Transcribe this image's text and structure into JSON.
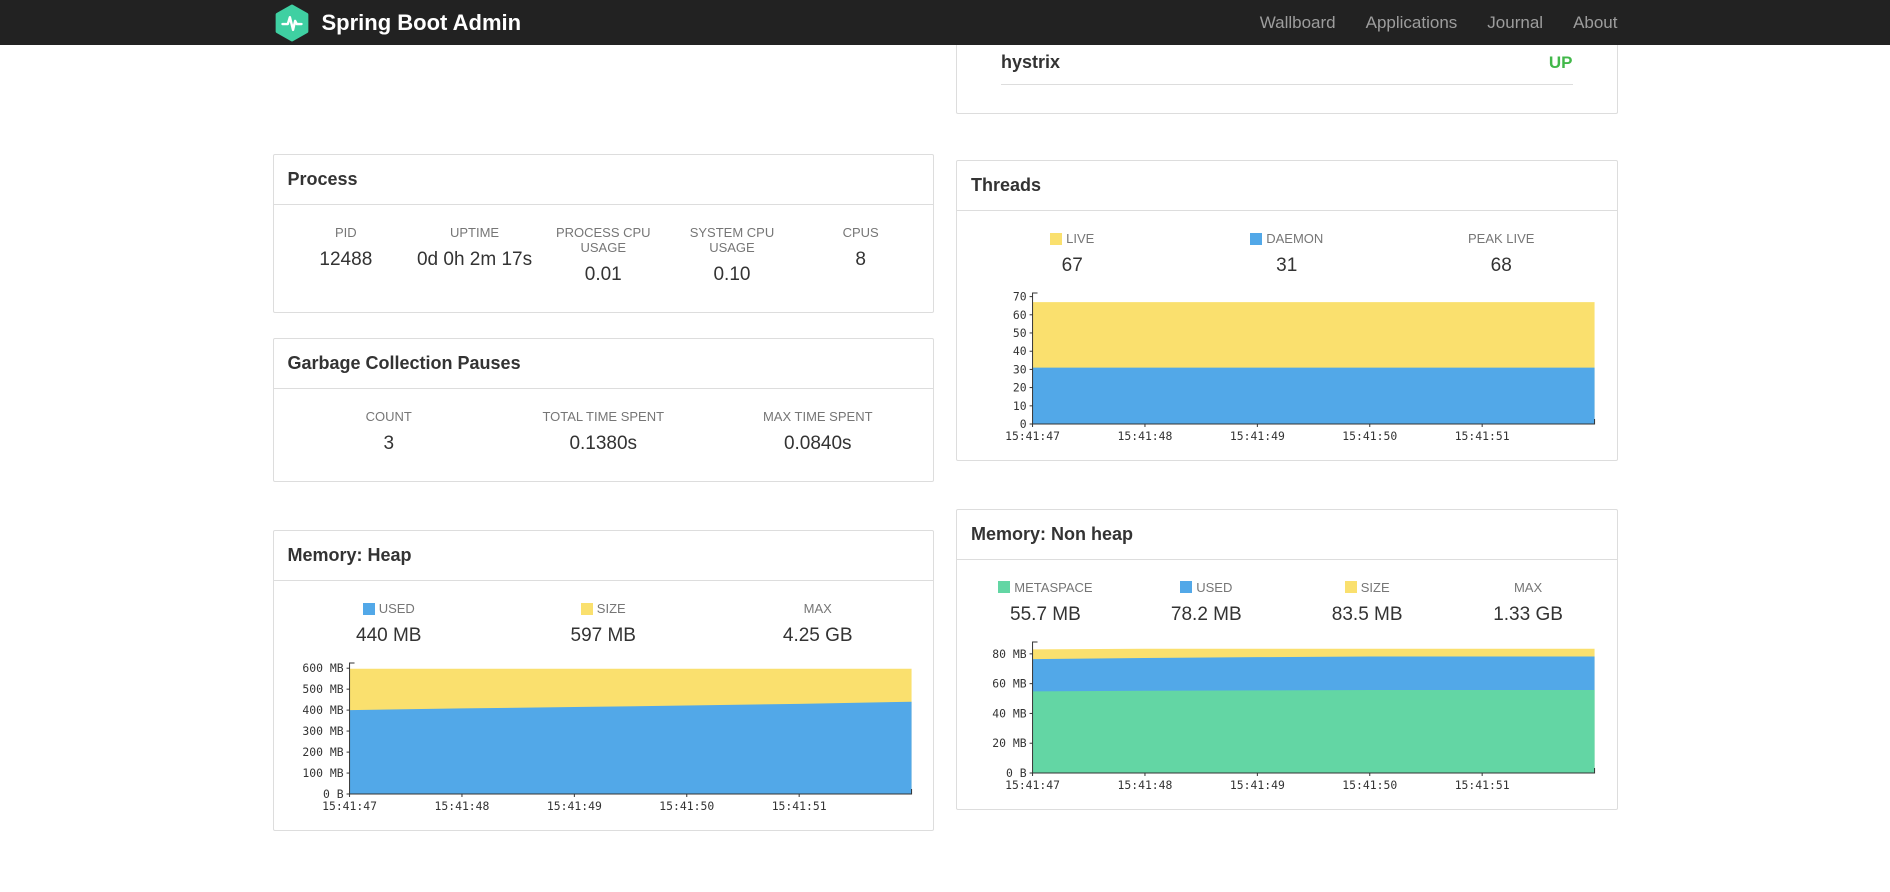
{
  "navbar": {
    "brand": "Spring Boot Admin",
    "links": [
      {
        "label": "Wallboard"
      },
      {
        "label": "Applications"
      },
      {
        "label": "Journal"
      },
      {
        "label": "About"
      }
    ]
  },
  "colors": {
    "accent_teal": "#3fd0a2",
    "status_up": "#42b84a",
    "series_yellow": "#fae06e",
    "series_blue": "#52a8e8",
    "series_green": "#63d6a4"
  },
  "health_row": {
    "name": "hystrix",
    "status": "UP",
    "status_color": "#42b84a"
  },
  "process": {
    "title": "Process",
    "stats": [
      {
        "label": "PID",
        "value": "12488"
      },
      {
        "label": "UPTIME",
        "value": "0d 0h 2m 17s"
      },
      {
        "label": "PROCESS CPU USAGE",
        "value": "0.01"
      },
      {
        "label": "SYSTEM CPU USAGE",
        "value": "0.10"
      },
      {
        "label": "CPUS",
        "value": "8"
      }
    ]
  },
  "gc": {
    "title": "Garbage Collection Pauses",
    "stats": [
      {
        "label": "COUNT",
        "value": "3"
      },
      {
        "label": "TOTAL TIME SPENT",
        "value": "0.1380s"
      },
      {
        "label": "MAX TIME SPENT",
        "value": "0.0840s"
      }
    ]
  },
  "threads": {
    "title": "Threads",
    "legend": [
      {
        "label": "LIVE",
        "value": "67",
        "color": "#fae06e"
      },
      {
        "label": "DAEMON",
        "value": "31",
        "color": "#52a8e8"
      },
      {
        "label": "PEAK LIVE",
        "value": "68"
      }
    ]
  },
  "heap": {
    "title": "Memory: Heap",
    "legend": [
      {
        "label": "USED",
        "value": "440 MB",
        "color": "#52a8e8"
      },
      {
        "label": "SIZE",
        "value": "597 MB",
        "color": "#fae06e"
      },
      {
        "label": "MAX",
        "value": "4.25 GB"
      }
    ]
  },
  "nonheap": {
    "title": "Memory: Non heap",
    "legend": [
      {
        "label": "METASPACE",
        "value": "55.7 MB",
        "color": "#63d6a4"
      },
      {
        "label": "USED",
        "value": "78.2 MB",
        "color": "#52a8e8"
      },
      {
        "label": "SIZE",
        "value": "83.5 MB",
        "color": "#fae06e"
      },
      {
        "label": "MAX",
        "value": "1.33 GB"
      }
    ]
  },
  "chart_data": [
    {
      "id": "threads",
      "type": "area",
      "title": "Threads",
      "x": [
        "15:41:47",
        "15:41:48",
        "15:41:49",
        "15:41:50",
        "15:41:51"
      ],
      "ylim": [
        0,
        72
      ],
      "grid": false,
      "legend_position": "top",
      "y_ticks": [
        {
          "v": 0,
          "label": "0"
        },
        {
          "v": 10,
          "label": "10"
        },
        {
          "v": 20,
          "label": "20"
        },
        {
          "v": 30,
          "label": "30"
        },
        {
          "v": 40,
          "label": "40"
        },
        {
          "v": 50,
          "label": "50"
        },
        {
          "v": 60,
          "label": "60"
        },
        {
          "v": 70,
          "label": "70"
        }
      ],
      "series": [
        {
          "name": "DAEMON",
          "color": "#52a8e8",
          "values": [
            31,
            31,
            31,
            31,
            31,
            31
          ]
        },
        {
          "name": "LIVE",
          "color": "#fae06e",
          "values": [
            67,
            67,
            67,
            67,
            67,
            67
          ]
        }
      ]
    },
    {
      "id": "heap",
      "type": "area",
      "title": "Memory: Heap",
      "x": [
        "15:41:47",
        "15:41:48",
        "15:41:49",
        "15:41:50",
        "15:41:51"
      ],
      "ylim": [
        0,
        625
      ],
      "grid": false,
      "legend_position": "top",
      "y_ticks": [
        {
          "v": 0,
          "label": "0 B"
        },
        {
          "v": 100,
          "label": "100 MB"
        },
        {
          "v": 200,
          "label": "200 MB"
        },
        {
          "v": 300,
          "label": "300 MB"
        },
        {
          "v": 400,
          "label": "400 MB"
        },
        {
          "v": 500,
          "label": "500 MB"
        },
        {
          "v": 600,
          "label": "600 MB"
        }
      ],
      "series": [
        {
          "name": "USED",
          "color": "#52a8e8",
          "values": [
            400,
            408,
            415,
            422,
            430,
            440
          ]
        },
        {
          "name": "SIZE",
          "color": "#fae06e",
          "values": [
            597,
            597,
            597,
            597,
            597,
            597
          ]
        }
      ]
    },
    {
      "id": "nonheap",
      "type": "area",
      "title": "Memory: Non heap",
      "x": [
        "15:41:47",
        "15:41:48",
        "15:41:49",
        "15:41:50",
        "15:41:51"
      ],
      "ylim": [
        0,
        88
      ],
      "grid": false,
      "legend_position": "top",
      "y_ticks": [
        {
          "v": 0,
          "label": "0 B"
        },
        {
          "v": 20,
          "label": "20 MB"
        },
        {
          "v": 40,
          "label": "40 MB"
        },
        {
          "v": 60,
          "label": "60 MB"
        },
        {
          "v": 80,
          "label": "80 MB"
        }
      ],
      "series": [
        {
          "name": "METASPACE",
          "color": "#63d6a4",
          "values": [
            54.8,
            55.2,
            55.5,
            55.7,
            55.7,
            55.7
          ]
        },
        {
          "name": "USED",
          "color": "#52a8e8",
          "values": [
            76.5,
            77.2,
            77.8,
            78.2,
            78.2,
            78.2
          ]
        },
        {
          "name": "SIZE",
          "color": "#fae06e",
          "values": [
            83.0,
            83.5,
            83.5,
            83.5,
            83.5,
            83.5
          ]
        }
      ]
    }
  ]
}
